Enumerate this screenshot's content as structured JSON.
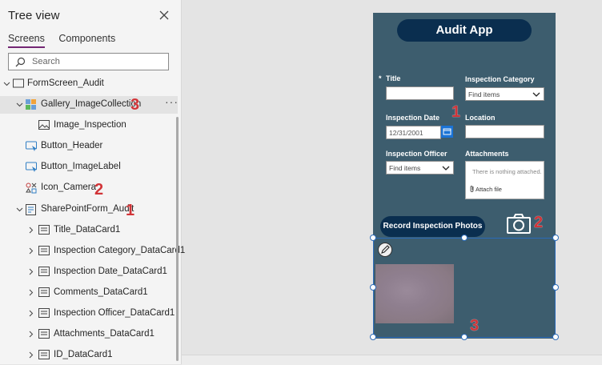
{
  "panel": {
    "title": "Tree view",
    "tabs": [
      {
        "label": "Screens",
        "active": true
      },
      {
        "label": "Components",
        "active": false
      }
    ],
    "search_placeholder": "Search"
  },
  "tree": [
    {
      "label": "FormScreen_Audit",
      "icon": "screen-icon",
      "expanded": true
    },
    {
      "label": "Gallery_ImageCollection",
      "icon": "gallery-icon",
      "expanded": true,
      "selected": true,
      "badge": "3"
    },
    {
      "label": "Image_Inspection",
      "icon": "image-icon"
    },
    {
      "label": "Button_Header",
      "icon": "button-icon"
    },
    {
      "label": "Button_ImageLabel",
      "icon": "button-icon"
    },
    {
      "label": "Icon_Camera",
      "icon": "icon-control-icon",
      "badge": "2"
    },
    {
      "label": "SharePointForm_Audit",
      "icon": "form-icon",
      "expanded": true,
      "badge": "1"
    },
    {
      "label": "Title_DataCard1",
      "icon": "card-icon"
    },
    {
      "label": "Inspection Category_DataCard1",
      "icon": "card-icon"
    },
    {
      "label": "Inspection Date_DataCard1",
      "icon": "card-icon"
    },
    {
      "label": "Comments_DataCard1",
      "icon": "card-icon"
    },
    {
      "label": "Inspection Officer_DataCard1",
      "icon": "card-icon"
    },
    {
      "label": "Attachments_DataCard1",
      "icon": "card-icon"
    },
    {
      "label": "ID_DataCard1",
      "icon": "card-icon"
    }
  ],
  "more_glyph": "···",
  "app": {
    "header": "Audit App",
    "required_mark": "*",
    "fields": {
      "title": "Title",
      "category": "Inspection Category",
      "category_value": "Find items",
      "date": "Inspection Date",
      "date_value": "12/31/2001",
      "location": "Location",
      "officer": "Inspection Officer",
      "officer_value": "Find items",
      "attachments": "Attachments",
      "attach_empty": "There is nothing attached.",
      "attach_file": "Attach file"
    },
    "record_button": "Record Inspection Photos"
  },
  "badges": {
    "form": "1",
    "camera": "2",
    "gallery": "3"
  },
  "colors": {
    "app_bg": "#3d5d6e",
    "button_bg": "#0a2e4f",
    "badge": "#d13438",
    "accent": "#742774"
  }
}
